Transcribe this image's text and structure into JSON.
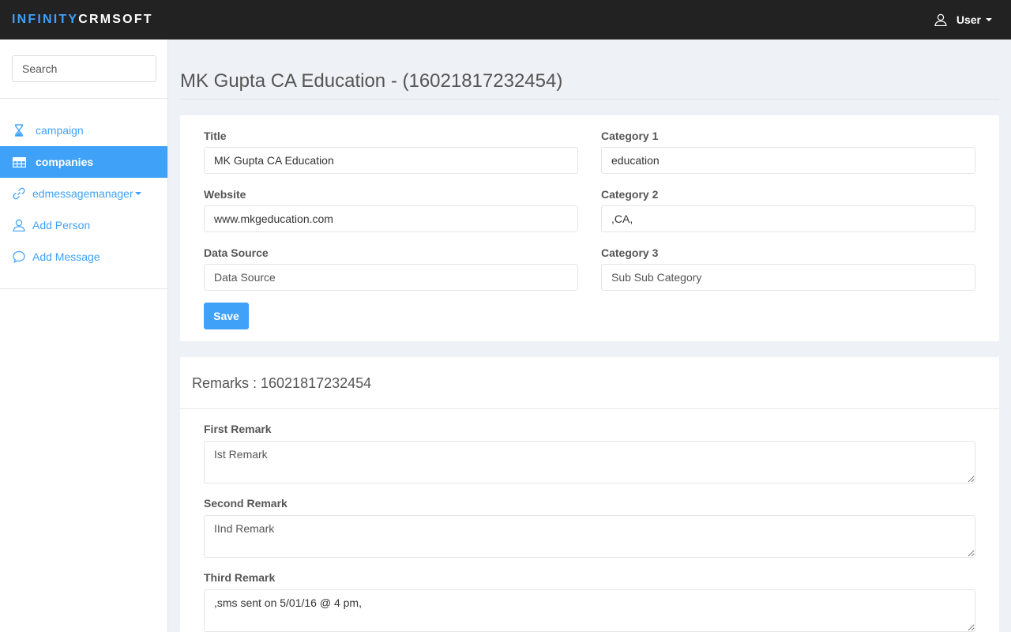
{
  "brand": {
    "part1": "INFINITY",
    "part2": "CRMSOFT"
  },
  "user_menu": {
    "label": "User"
  },
  "sidebar": {
    "search_placeholder": "Search",
    "items": [
      {
        "label": "campaign",
        "icon": "hourglass-icon"
      },
      {
        "label": "companies",
        "icon": "table-icon",
        "active": true
      },
      {
        "label": "edmessagemanager",
        "icon": "link-icon",
        "dropdown": true
      },
      {
        "label": "Add Person",
        "icon": "user-icon"
      },
      {
        "label": "Add Message",
        "icon": "comment-icon"
      }
    ]
  },
  "page": {
    "title": "MK Gupta CA Education - (16021817232454)"
  },
  "form": {
    "title_label": "Title",
    "title_value": "MK Gupta CA Education",
    "website_label": "Website",
    "website_value": "www.mkgeducation.com",
    "data_source_label": "Data Source",
    "data_source_placeholder": "Data Source",
    "category1_label": "Category 1",
    "category1_value": "education",
    "category2_label": "Category 2",
    "category2_value": ",CA,",
    "category3_label": "Category 3",
    "category3_placeholder": "Sub Sub Category",
    "save_label": "Save"
  },
  "remarks": {
    "heading": "Remarks : 16021817232454",
    "first_label": "First Remark",
    "first_placeholder": "Ist Remark",
    "second_label": "Second Remark",
    "second_placeholder": "IInd Remark",
    "third_label": "Third Remark",
    "third_value": ",sms sent on 5/01/16 @ 4 pm,"
  },
  "colors": {
    "accent": "#3fa1f8",
    "navbar": "#222222",
    "background": "#eef1f5"
  }
}
